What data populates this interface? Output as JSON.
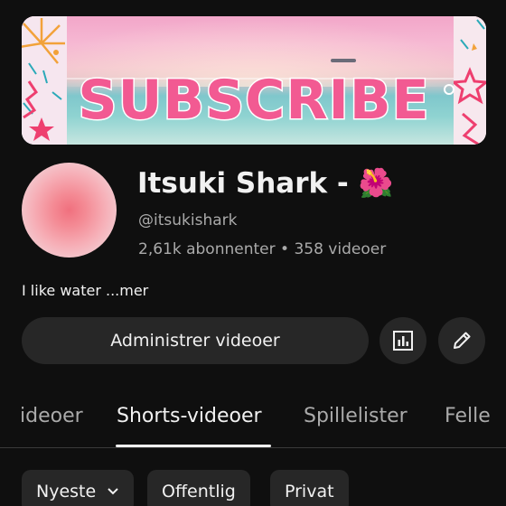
{
  "banner": {
    "text": "SUBSCRIBE"
  },
  "channel": {
    "name": "Itsuki Shark -",
    "name_emoji": "🌺",
    "handle": "@itsukishark",
    "subscribers": "2,61k abonnenter",
    "separator": "•",
    "videos": "358 videoer",
    "bio": "I like water ...mer"
  },
  "actions": {
    "manage_label": "Administrer videoer",
    "analytics_icon": "bar-chart-icon",
    "edit_icon": "pencil-icon"
  },
  "tabs": [
    {
      "label": "ideoer",
      "active": false
    },
    {
      "label": "Shorts-videoer",
      "active": true
    },
    {
      "label": "Spillelister",
      "active": false
    },
    {
      "label": "Felle",
      "active": false
    }
  ],
  "filters": [
    {
      "label": "Nyeste",
      "has_dropdown": true
    },
    {
      "label": "Offentlig",
      "has_dropdown": false
    },
    {
      "label": "Privat",
      "has_dropdown": false
    }
  ],
  "colors": {
    "background": "#0f0f0f",
    "surface": "#272727",
    "text_primary": "#f1f1f1",
    "text_secondary": "#aaaaaa",
    "banner_text": "#f25a92"
  }
}
